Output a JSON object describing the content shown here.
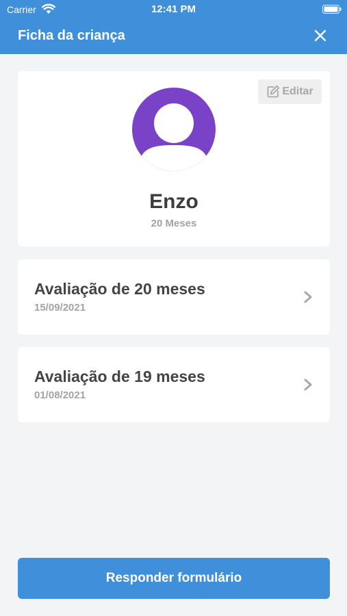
{
  "status_bar": {
    "carrier": "Carrier",
    "time": "12:41 PM"
  },
  "navbar": {
    "title": "Ficha da criança",
    "close_icon": "close-icon"
  },
  "profile": {
    "edit_label": "Editar",
    "name": "Enzo",
    "age": "20 Meses",
    "avatar_color": "#7a43c7"
  },
  "evaluations": [
    {
      "title": "Avaliação de 20 meses",
      "date": "15/09/2021"
    },
    {
      "title": "Avaliação de 19 meses",
      "date": "01/08/2021"
    }
  ],
  "footer": {
    "submit_label": "Responder formulário"
  },
  "colors": {
    "primary": "#3f8fdb",
    "background": "#f3f4f6"
  }
}
